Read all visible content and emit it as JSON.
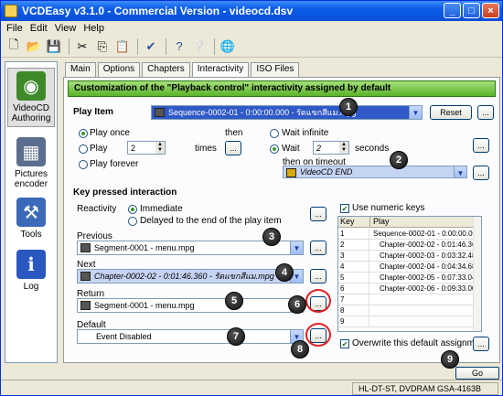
{
  "window": {
    "title": "VCDEasy v3.1.0 - Commercial Version - videocd.dsv"
  },
  "menu": [
    "File",
    "Edit",
    "View",
    "Help"
  ],
  "toolbar": {
    "icons": [
      "new-icon",
      "open-icon",
      "save-icon",
      "cut-icon",
      "copy-icon",
      "paste-icon",
      "check-icon",
      "help-icon",
      "whats-this-icon",
      "web-icon"
    ]
  },
  "sidebar": {
    "items": [
      {
        "label": "VideoCD Authoring",
        "icon": "disc-icon",
        "active": true
      },
      {
        "label": "Pictures encoder",
        "icon": "film-icon"
      },
      {
        "label": "Tools",
        "icon": "tools-icon"
      },
      {
        "label": "Log",
        "icon": "log-icon"
      }
    ]
  },
  "tabs": [
    "Main",
    "Options",
    "Chapters",
    "Interactivity",
    "ISO Files"
  ],
  "banner": "Customization of the \"Playback control\" interactivity assigned by default",
  "play_item": {
    "label": "Play Item",
    "value": "Sequence-0002-01 - 0:00:00.000 - รัดแขกสีแม.mpg",
    "reset_label": "Reset"
  },
  "play_mode": {
    "play_once": "Play once",
    "play": "Play",
    "play_count": "2",
    "times": "times",
    "play_forever": "Play forever",
    "then": "then",
    "wait_infinite": "Wait infinite",
    "wait": "Wait",
    "wait_seconds": "2",
    "seconds": "seconds",
    "then_on_timeout": "then on timeout",
    "timeout_value": "VideoCD END"
  },
  "key_pressed": {
    "heading": "Key pressed interaction",
    "reactivity": "Reactivity",
    "immediate": "Immediate",
    "delayed": "Delayed to the end of the play item",
    "previous_label": "Previous",
    "previous_value": "Segment-0001 - menu.mpg",
    "next_label": "Next",
    "next_value": "Chapter-0002-02 - 0:01:46.360 - รัดแขกสีแม.mpg",
    "return_label": "Return",
    "return_value": "Segment-0001 - menu.mpg",
    "default_label": "Default",
    "default_value": "Event Disabled"
  },
  "numeric_keys": {
    "checkbox_label": "Use numeric keys",
    "col_key": "Key",
    "col_play": "Play",
    "rows": [
      {
        "key": "1",
        "play": "Sequence-0002-01 - 0:00:00.000"
      },
      {
        "key": "2",
        "play": "Chapter-0002-02 - 0:01:46.360"
      },
      {
        "key": "3",
        "play": "Chapter-0002-03 - 0:03:32.480"
      },
      {
        "key": "4",
        "play": "Chapter-0002-04 - 0:04:34.680"
      },
      {
        "key": "5",
        "play": "Chapter-0002-05 - 0:07:33.040"
      },
      {
        "key": "6",
        "play": "Chapter-0002-06 - 0:09:33.000"
      },
      {
        "key": "7",
        "play": ""
      },
      {
        "key": "8",
        "play": ""
      },
      {
        "key": "9",
        "play": ""
      }
    ],
    "overwrite_label": "Overwrite this default assignment"
  },
  "ellipsis": "...",
  "go_label": "Go",
  "status": "HL-DT-ST, DVDRAM GSA-4163B",
  "callouts": [
    "1",
    "2",
    "3",
    "4",
    "5",
    "6",
    "7",
    "8",
    "9"
  ]
}
